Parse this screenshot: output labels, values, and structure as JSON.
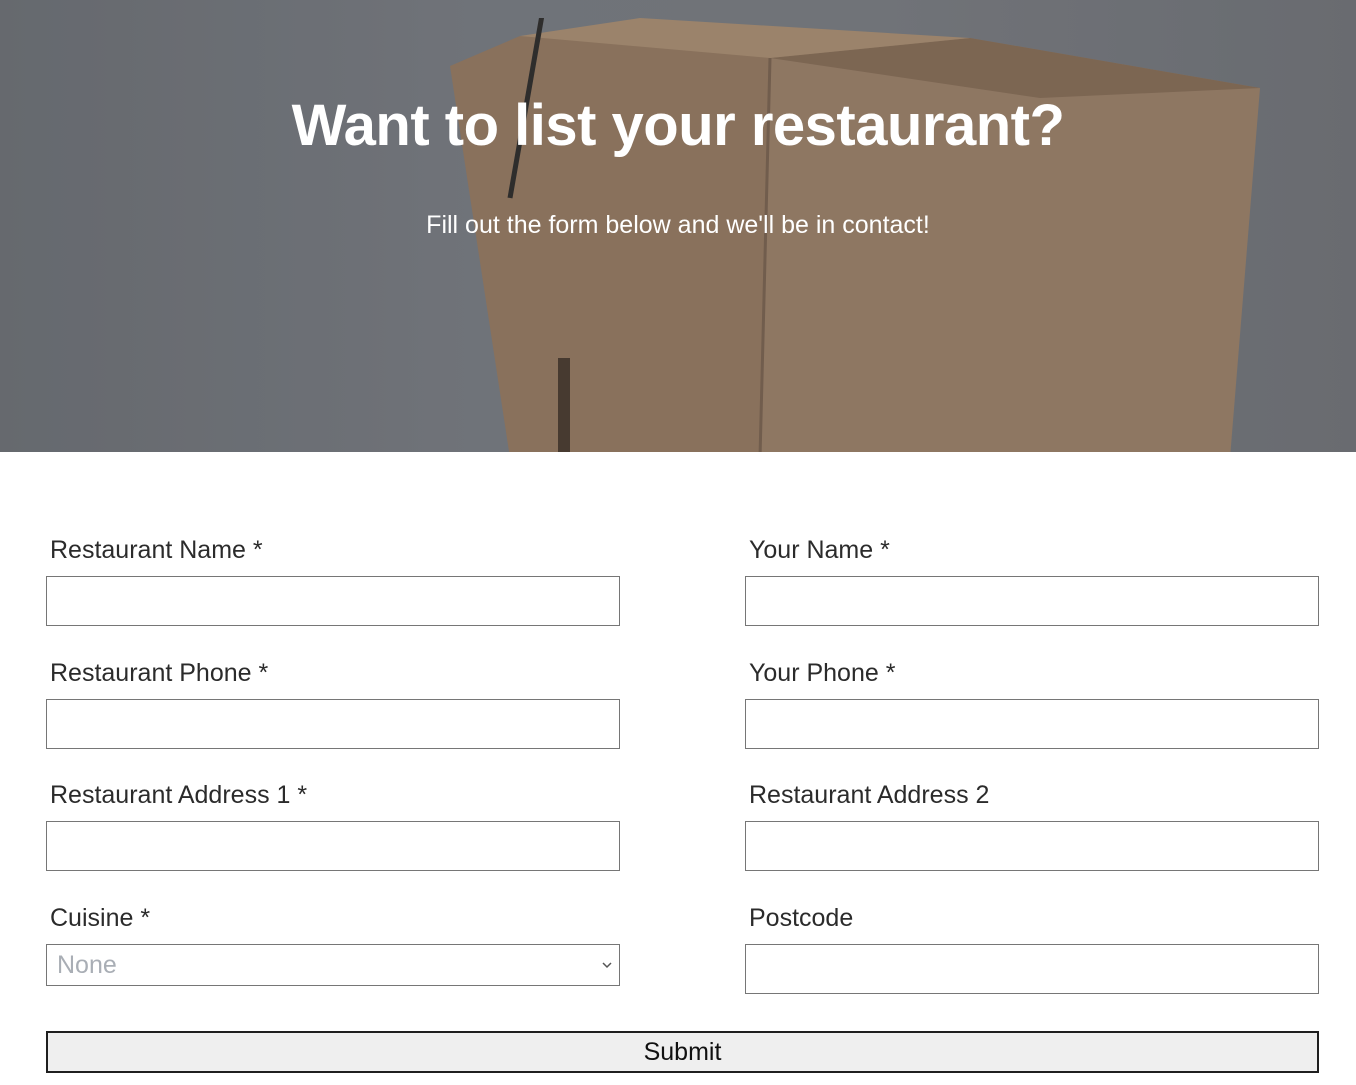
{
  "hero": {
    "title": "Want to list your restaurant?",
    "subtitle": "Fill out the form below and we'll be in contact!"
  },
  "form": {
    "restaurant_name_label": "Restaurant Name *",
    "your_name_label": "Your Name *",
    "restaurant_phone_label": "Restaurant Phone *",
    "your_phone_label": "Your Phone *",
    "restaurant_address_1_label": "Restaurant Address 1 *",
    "restaurant_address_2_label": "Restaurant Address 2",
    "cuisine_label": "Cuisine *",
    "cuisine_value": "None",
    "postcode_label": "Postcode",
    "submit_label": "Submit"
  },
  "colors": {
    "input_border": "#767676",
    "placeholder_gray": "#a9aeb5",
    "button_bg": "#efefef"
  },
  "icons": {
    "select_arrow": "chevron-down-icon"
  }
}
